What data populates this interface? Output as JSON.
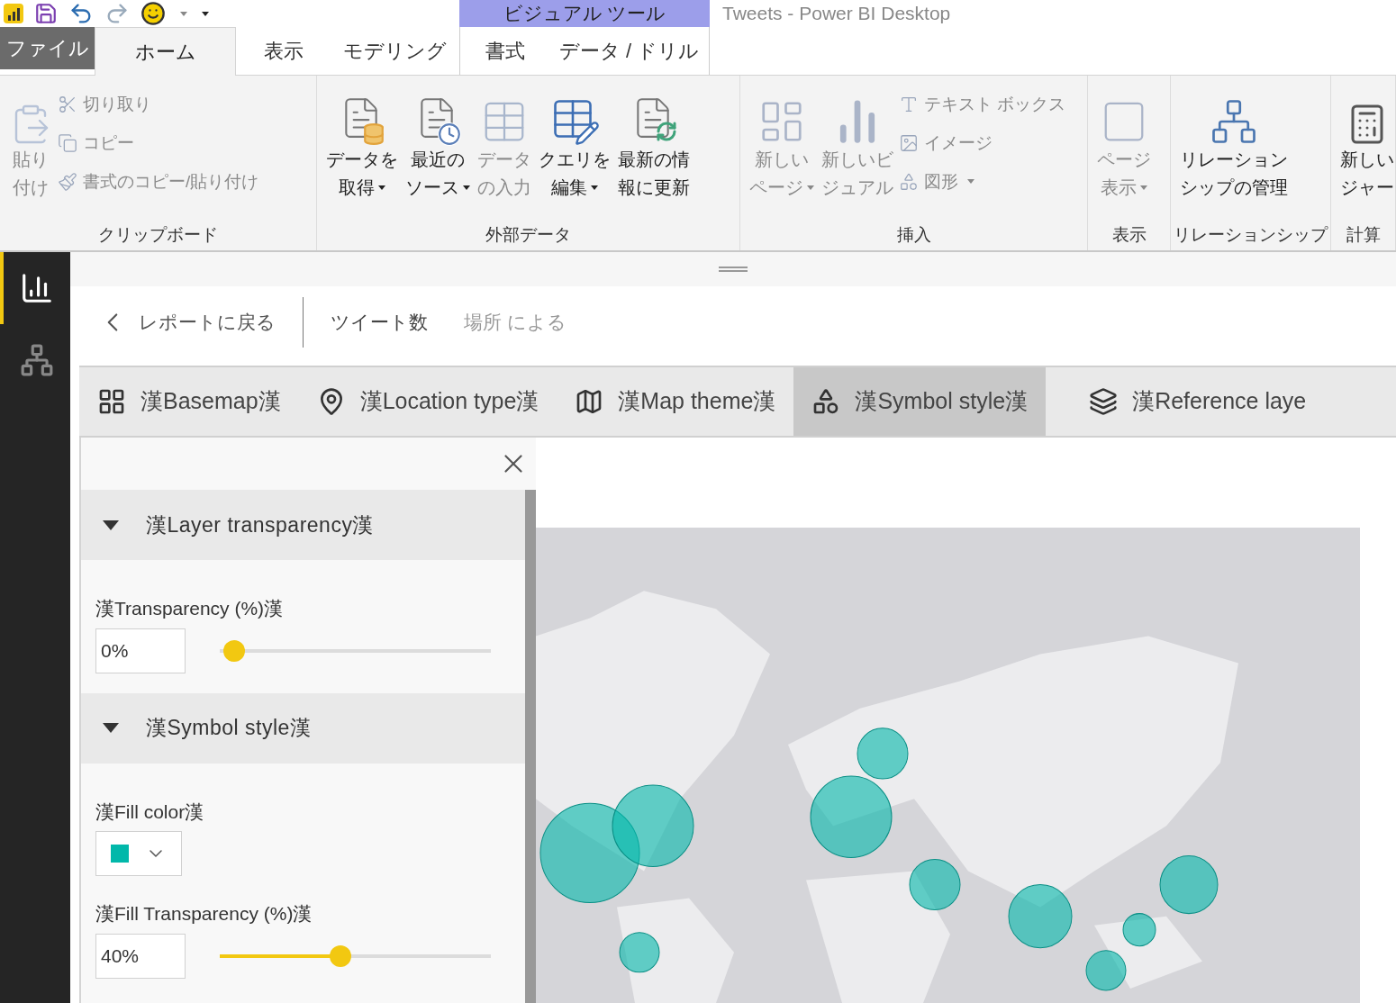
{
  "window": {
    "title": "Tweets - Power BI Desktop",
    "contextual_group": "ビジュアル ツール"
  },
  "ribbon_tabs": [
    {
      "label": "ファイル",
      "kind": "file",
      "selected": false
    },
    {
      "label": "ホーム",
      "kind": "tab",
      "selected": true
    },
    {
      "label": "表示",
      "kind": "tab",
      "selected": false
    },
    {
      "label": "モデリング",
      "kind": "tab",
      "selected": false
    },
    {
      "label": "書式",
      "kind": "contextual",
      "selected": false
    },
    {
      "label": "データ / ドリル",
      "kind": "contextual",
      "selected": false
    }
  ],
  "ribbon_groups": [
    {
      "label": "クリップボード",
      "items": [
        {
          "kind": "large",
          "lines": [
            "貼り",
            "付け"
          ],
          "disabled": true,
          "dropdown": false
        },
        {
          "kind": "small",
          "label": "切り取り",
          "disabled": true,
          "dropdown": false
        },
        {
          "kind": "small",
          "label": "コピー",
          "disabled": true,
          "dropdown": false
        },
        {
          "kind": "small",
          "label": "書式のコピー/貼り付け",
          "disabled": true,
          "dropdown": false
        }
      ]
    },
    {
      "label": "外部データ",
      "items": [
        {
          "kind": "large",
          "lines": [
            "データを",
            "取得"
          ],
          "disabled": false,
          "dropdown": true
        },
        {
          "kind": "large",
          "lines": [
            "最近の",
            "ソース"
          ],
          "disabled": false,
          "dropdown": true
        },
        {
          "kind": "large",
          "lines": [
            "データ",
            "の入力"
          ],
          "disabled": true,
          "dropdown": false
        },
        {
          "kind": "large",
          "lines": [
            "クエリを",
            "編集"
          ],
          "disabled": false,
          "dropdown": true
        },
        {
          "kind": "large",
          "lines": [
            "最新の情",
            "報に更新"
          ],
          "disabled": false,
          "dropdown": false
        }
      ]
    },
    {
      "label": "挿入",
      "items": [
        {
          "kind": "large",
          "lines": [
            "新しい",
            "ページ"
          ],
          "disabled": true,
          "dropdown": true
        },
        {
          "kind": "large",
          "lines": [
            "新しいビ",
            "ジュアル"
          ],
          "disabled": true,
          "dropdown": false
        },
        {
          "kind": "small",
          "label": "テキスト ボックス",
          "disabled": true,
          "dropdown": false
        },
        {
          "kind": "small",
          "label": "イメージ",
          "disabled": true,
          "dropdown": false
        },
        {
          "kind": "small",
          "label": "図形",
          "disabled": true,
          "dropdown": true
        }
      ]
    },
    {
      "label": "表示",
      "items": [
        {
          "kind": "large",
          "lines": [
            "ページ",
            "表示"
          ],
          "disabled": true,
          "dropdown": true
        }
      ]
    },
    {
      "label": "リレーションシップ",
      "items": [
        {
          "kind": "large",
          "lines": [
            "リレーション",
            "シップの管理"
          ],
          "disabled": false,
          "dropdown": false
        }
      ]
    },
    {
      "label": "計算",
      "items": [
        {
          "kind": "large",
          "lines": [
            "新しい",
            "ジャー"
          ],
          "disabled": false,
          "dropdown": false
        }
      ]
    }
  ],
  "sidebar": {
    "items": [
      {
        "selected": true
      },
      {
        "selected": false
      }
    ]
  },
  "breadcrumb": {
    "back": "レポートに戻る",
    "field": "ツイート数",
    "by": "場所 による"
  },
  "format_tabs": [
    {
      "label": "漢Basemap漢",
      "selected": false
    },
    {
      "label": "漢Location type漢",
      "selected": false
    },
    {
      "label": "漢Map theme漢",
      "selected": false
    },
    {
      "label": "漢Symbol style漢",
      "selected": true
    },
    {
      "label": "漢Reference laye",
      "selected": false
    }
  ],
  "panel": {
    "sections": [
      {
        "title": "漢Layer transparency漢",
        "expanded": true,
        "fields": [
          {
            "kind": "slider",
            "label": "漢Transparency (%)漢",
            "value": "0%",
            "level": 0
          }
        ]
      },
      {
        "title": "漢Symbol style漢",
        "expanded": true,
        "fields": [
          {
            "kind": "color",
            "label": "漢Fill color漢",
            "color": "#01b8aa"
          },
          {
            "kind": "slider",
            "label": "漢Fill Transparency (%)漢",
            "value": "40%",
            "level": 0.41
          }
        ]
      }
    ]
  }
}
